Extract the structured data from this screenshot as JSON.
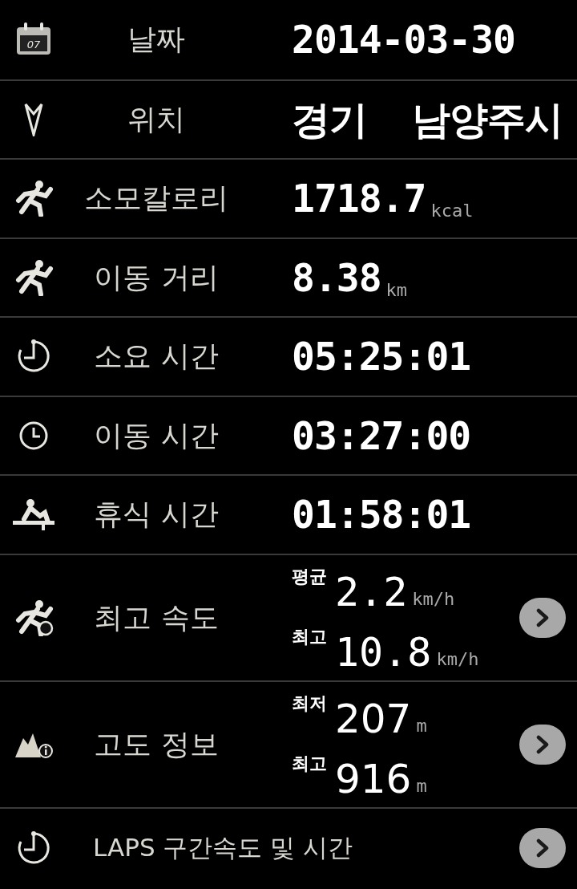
{
  "rows": [
    {
      "kind": "single",
      "icon_text": "07",
      "label": "날짜",
      "value": "2014-03-30"
    },
    {
      "kind": "single",
      "label": "위치",
      "value": "경기  남양주시"
    },
    {
      "kind": "single",
      "label": "소모칼로리",
      "value": "1718.7",
      "unit": "kcal"
    },
    {
      "kind": "single",
      "label": "이동 거리",
      "value": "8.38",
      "unit": "km"
    },
    {
      "kind": "single",
      "label": "소요 시간",
      "value": "05:25:01"
    },
    {
      "kind": "single",
      "label": "이동 시간",
      "value": "03:27:00"
    },
    {
      "kind": "single",
      "label": "휴식 시간",
      "value": "01:58:01"
    },
    {
      "kind": "pair",
      "label": "최고 속도",
      "entries": [
        {
          "label": "평균",
          "value": "2.2",
          "unit": "km/h"
        },
        {
          "label": "최고",
          "value": "10.8",
          "unit": "km/h"
        }
      ]
    },
    {
      "kind": "pair",
      "label": "고도 정보",
      "entries": [
        {
          "label": "최저",
          "value": "207",
          "unit": "m"
        },
        {
          "label": "최고",
          "value": "916",
          "unit": "m"
        }
      ]
    },
    {
      "kind": "link",
      "label": "LAPS 구간속도 및 시간"
    }
  ]
}
